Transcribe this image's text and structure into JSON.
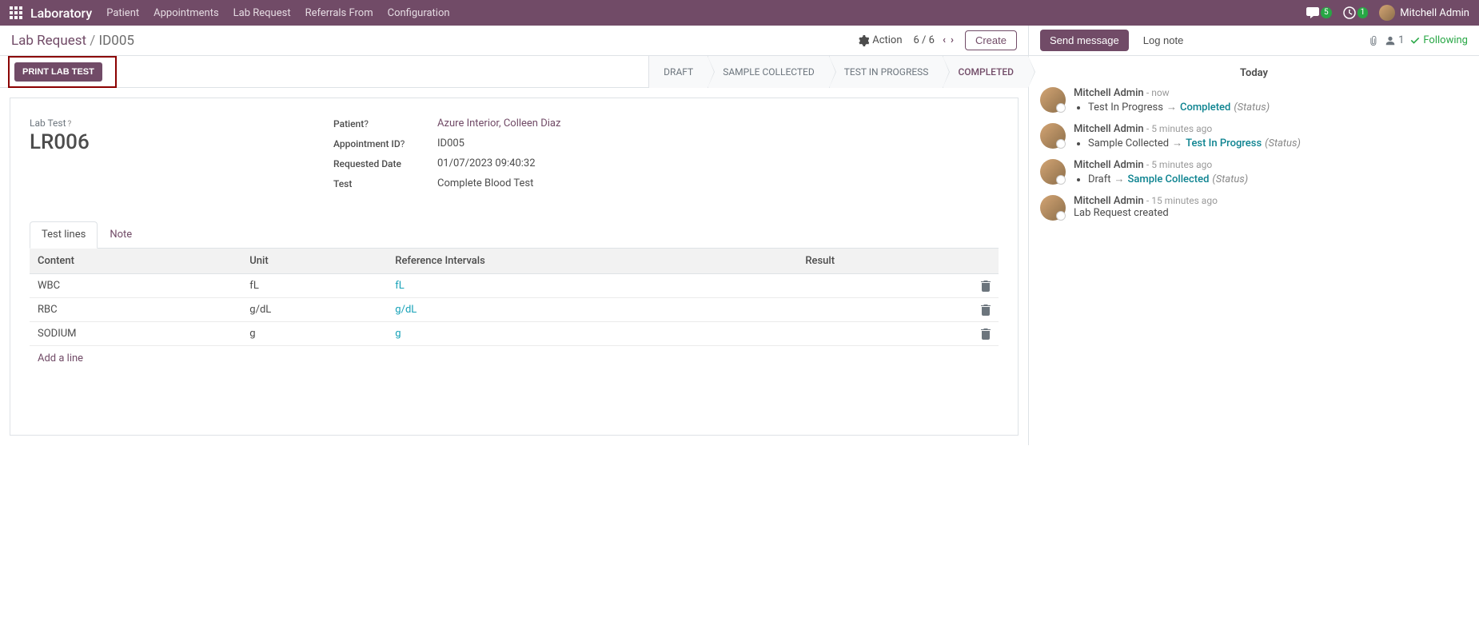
{
  "topbar": {
    "app_name": "Laboratory",
    "menu": [
      "Patient",
      "Appointments",
      "Lab Request",
      "Referrals From",
      "Configuration"
    ],
    "chat_badge": "5",
    "clock_badge": "1",
    "user_name": "Mitchell Admin"
  },
  "control": {
    "breadcrumb_root": "Lab Request",
    "breadcrumb_current": "ID005",
    "action_label": "Action",
    "pager_text": "6 / 6",
    "create_label": "Create"
  },
  "statusbar": {
    "print_label": "PRINT LAB TEST",
    "stages": [
      "DRAFT",
      "SAMPLE COLLECTED",
      "TEST IN PROGRESS",
      "COMPLETED"
    ]
  },
  "form": {
    "labtest_label": "Lab Test",
    "labtest_value": "LR006",
    "patient_label": "Patient",
    "patient_value": "Azure Interior, Colleen Diaz",
    "appointment_label": "Appointment ID",
    "appointment_value": "ID005",
    "reqdate_label": "Requested Date",
    "reqdate_value": "01/07/2023 09:40:32",
    "test_label": "Test",
    "test_value": "Complete Blood Test"
  },
  "tabs": {
    "test_lines": "Test lines",
    "note": "Note"
  },
  "table": {
    "headers": {
      "content": "Content",
      "unit": "Unit",
      "ref": "Reference Intervals",
      "result": "Result"
    },
    "rows": [
      {
        "content": "WBC",
        "unit": "fL",
        "ref": "fL",
        "result": ""
      },
      {
        "content": "RBC",
        "unit": "g/dL",
        "ref": "g/dL",
        "result": ""
      },
      {
        "content": "SODIUM",
        "unit": "g",
        "ref": "g",
        "result": ""
      }
    ],
    "add_line": "Add a line"
  },
  "chatter": {
    "send_message": "Send message",
    "log_note": "Log note",
    "follower_count": "1",
    "following_label": "Following",
    "today_label": "Today",
    "messages": [
      {
        "author": "Mitchell Admin",
        "time": "now",
        "type": "status",
        "old": "Test In Progress",
        "new": "Completed",
        "status_label": "(Status)"
      },
      {
        "author": "Mitchell Admin",
        "time": "5 minutes ago",
        "type": "status",
        "old": "Sample Collected",
        "new": "Test In Progress",
        "status_label": "(Status)"
      },
      {
        "author": "Mitchell Admin",
        "time": "5 minutes ago",
        "type": "status",
        "old": "Draft",
        "new": "Sample Collected",
        "status_label": "(Status)"
      },
      {
        "author": "Mitchell Admin",
        "time": "15 minutes ago",
        "type": "text",
        "text": "Lab Request created"
      }
    ]
  }
}
